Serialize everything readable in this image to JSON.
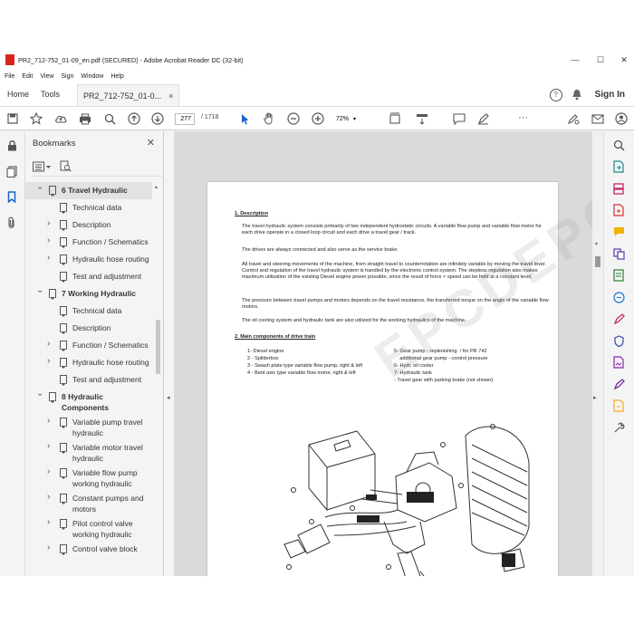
{
  "window": {
    "title": "PR2_712-752_01-09_en.pdf (SECURED) - Adobe Acrobat Reader DC (32-bit)",
    "controls": [
      "—",
      "☐",
      "✕"
    ]
  },
  "menu": [
    "File",
    "Edit",
    "View",
    "Sign",
    "Window",
    "Help"
  ],
  "tabs": {
    "home": "Home",
    "tools": "Tools",
    "doc": "PR2_712-752_01-0...",
    "close": "×",
    "signin": "Sign In",
    "help_icon": "?"
  },
  "toolbar": {
    "page_current": "277",
    "page_total": "/ 1718",
    "zoom": "72%",
    "more": "···"
  },
  "bookmarks": {
    "header": "Bookmarks",
    "close": "✕",
    "items": [
      {
        "label": "6 Travel Hydraulic",
        "level": 0,
        "expanded": true,
        "selected": true
      },
      {
        "label": "Technical data",
        "level": 1
      },
      {
        "label": "Description",
        "level": 1,
        "expandable": true
      },
      {
        "label": "Function / Schematics",
        "level": 1,
        "expandable": true
      },
      {
        "label": "Hydraulic hose routing",
        "level": 1,
        "expandable": true
      },
      {
        "label": "Test and adjustment",
        "level": 1
      },
      {
        "label": "7 Working Hydraulic",
        "level": 0,
        "expanded": true
      },
      {
        "label": "Technical data",
        "level": 1
      },
      {
        "label": "Description",
        "level": 1
      },
      {
        "label": "Function / Schematics",
        "level": 1,
        "expandable": true
      },
      {
        "label": "Hydraulic hose routing",
        "level": 1,
        "expandable": true
      },
      {
        "label": "Test and adjustment",
        "level": 1
      },
      {
        "label": "8 Hydraulic Components",
        "level": 0,
        "expanded": true
      },
      {
        "label": "Variable pump travel hydraulic",
        "level": 1,
        "expandable": true
      },
      {
        "label": "Variable motor travel hydraulic",
        "level": 1,
        "expandable": true
      },
      {
        "label": "Variable flow pump working hydraulic",
        "level": 1,
        "expandable": true
      },
      {
        "label": "Constant pumps and motors",
        "level": 1,
        "expandable": true
      },
      {
        "label": "Pilot control valve working hydraulic",
        "level": 1,
        "expandable": true
      },
      {
        "label": "Control valve block",
        "level": 1,
        "expandable": true
      }
    ]
  },
  "document": {
    "section1_title": "1. Description",
    "p1": "The travel hydraulic system consists primarily of two independent hydrostatic circuits. A variable flow pump and variable flow motor for each drive operate in a closed loop circuit and each drive a travel gear / track.",
    "p2": "The drives are always connected and also serve as the service brake.",
    "p3": "All travel and steering movements of the machine, from straight travel to counterrotation are infinitely variable by moving the travel lever. Control and regulation of the travel hydraulic system is handled by the electronic control system. The stepless regulation also makes maximum utilization of the existing Diesel engine power possible, since the result of force × speed can be held at a constant level.",
    "p4": "The pressure between travel pumps and motors depends on the travel resistance, the transferred torque on the angle of the variable flow motors.",
    "p5": "The oil cooling system and hydraulic tank are also utilized for the working hydraulics of the machine.",
    "section2_title": "2. Main components of drive train",
    "left_list": [
      "1- Diesel engine",
      "2 - Splitterbox",
      "3 - Swash plate type variable flow pump, right & left",
      "4 - Bent axis type variable flow motor, right & left"
    ],
    "right_list": [
      "5- Gear pump - replenishing  / for PR 742",
      "    additional gear pump - control pressure",
      "6- Hydr. oil cooler",
      "7- Hydraulic tank",
      "-   Travel gear with parking brake (not shown)"
    ],
    "watermark": "EPCDEPO"
  }
}
